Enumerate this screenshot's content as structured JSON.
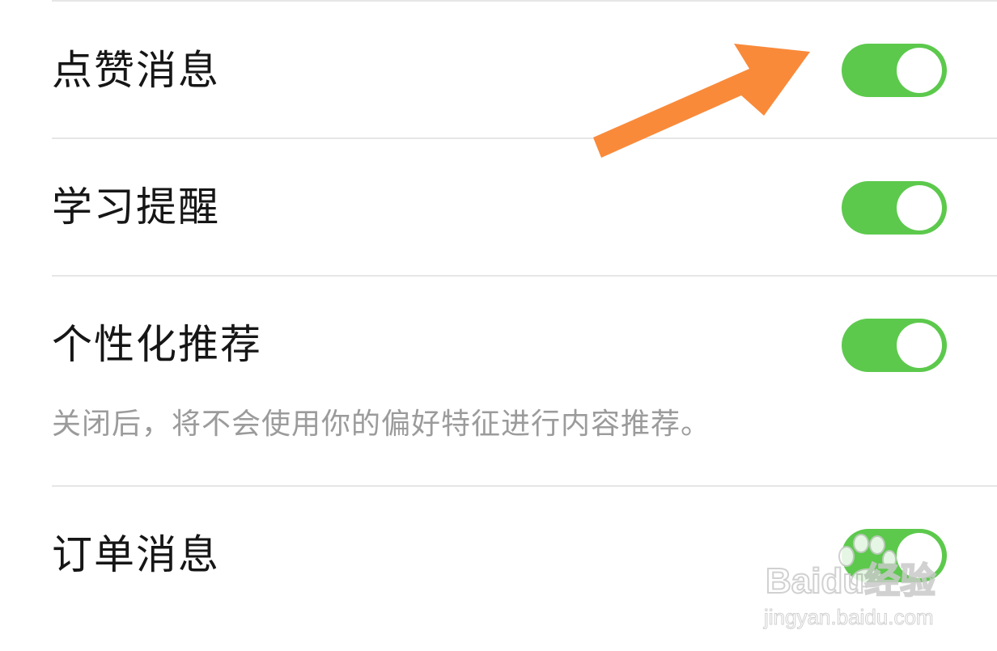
{
  "settings": [
    {
      "label": "点赞消息",
      "enabled": true
    },
    {
      "label": "学习提醒",
      "enabled": true
    },
    {
      "label": "个性化推荐",
      "enabled": true,
      "description": "关闭后，将不会使用你的偏好特征进行内容推荐。"
    },
    {
      "label": "订单消息",
      "enabled": true
    }
  ],
  "annotation": {
    "arrow_color": "#f98a3a",
    "points_to": "点赞消息 toggle"
  },
  "colors": {
    "toggle_on": "#5cc94c",
    "divider": "#e6e6e6",
    "description_text": "#9b9b9b"
  },
  "watermark": {
    "brand": "Baidu经验",
    "url": "jingyan.baidu.com"
  }
}
